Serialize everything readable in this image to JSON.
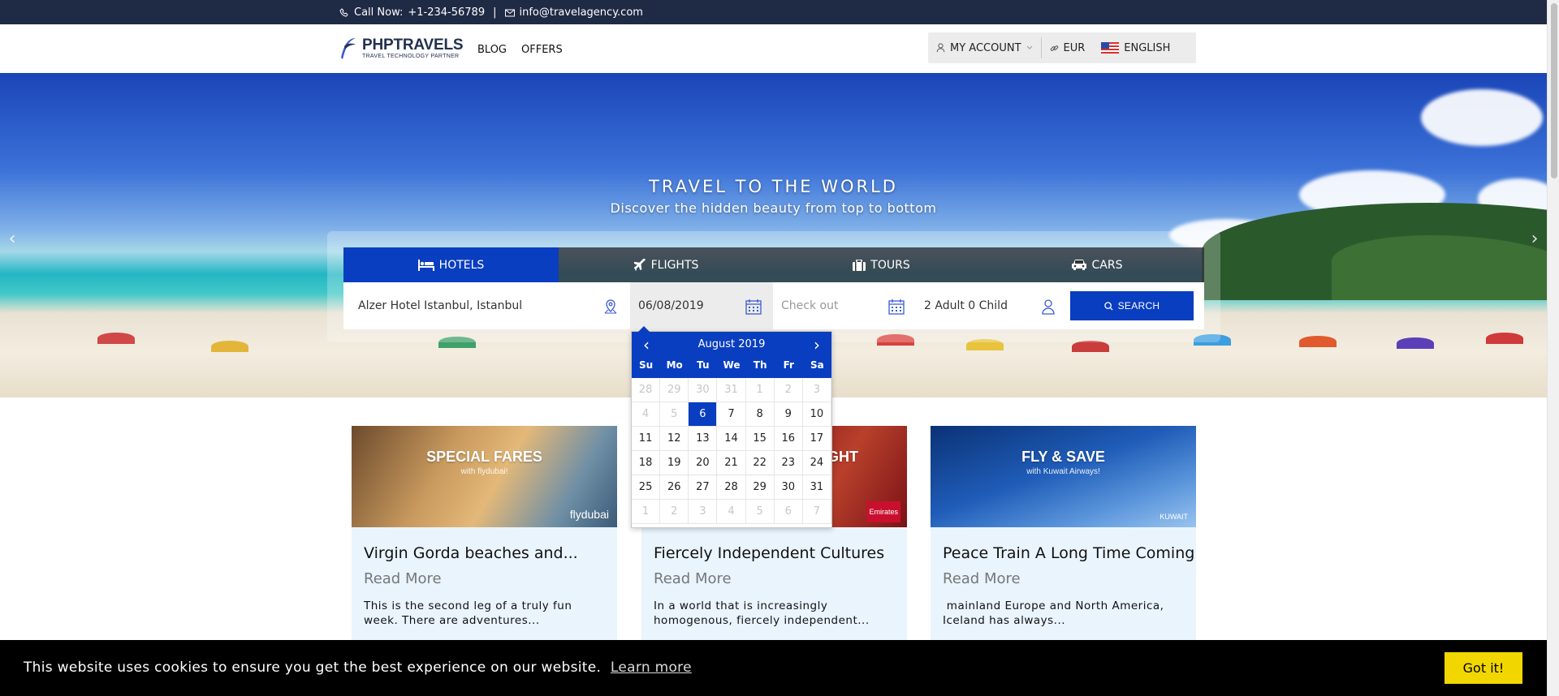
{
  "topbar": {
    "call_label": "Call Now:",
    "phone": "+1-234-56789",
    "separator": "|",
    "email": "info@travelagency.com"
  },
  "logo": {
    "name": "PHPTRAVELS",
    "tagline": "TRAVEL TECHNOLOGY PARTNER"
  },
  "nav": {
    "blog": "BLOG",
    "offers": "OFFERS"
  },
  "account": {
    "my_account": "MY ACCOUNT",
    "currency": "EUR",
    "language": "ENGLISH"
  },
  "hero": {
    "title": "TRAVEL TO THE WORLD",
    "subtitle": "Discover the hidden beauty from top to bottom"
  },
  "tabs": [
    {
      "label": "HOTELS",
      "icon": "bed-icon"
    },
    {
      "label": "FLIGHTS",
      "icon": "plane-icon"
    },
    {
      "label": "TOURS",
      "icon": "suitcase-icon"
    },
    {
      "label": "CARS",
      "icon": "car-icon"
    }
  ],
  "search": {
    "location": "Alzer Hotel Istanbul, Istanbul",
    "checkin": "06/08/2019",
    "checkout_placeholder": "Check out",
    "guests": "2 Adult 0 Child",
    "button": "SEARCH"
  },
  "datepicker": {
    "month_label": "August 2019",
    "weekdays": [
      "Su",
      "Mo",
      "Tu",
      "We",
      "Th",
      "Fr",
      "Sa"
    ],
    "days": [
      [
        "28",
        "29",
        "30",
        "31",
        "1",
        "2",
        "3"
      ],
      [
        "4",
        "5",
        "6",
        "7",
        "8",
        "9",
        "10"
      ],
      [
        "11",
        "12",
        "13",
        "14",
        "15",
        "16",
        "17"
      ],
      [
        "18",
        "19",
        "20",
        "21",
        "22",
        "23",
        "24"
      ],
      [
        "25",
        "26",
        "27",
        "28",
        "29",
        "30",
        "31"
      ],
      [
        "1",
        "2",
        "3",
        "4",
        "5",
        "6",
        "7"
      ]
    ],
    "selected_day": "6"
  },
  "cards": [
    {
      "banner_title": "SPECIAL FARES",
      "banner_subtitle": "with flydubai!",
      "brand": "flydubai",
      "title": "Virgin Gorda beaches and...",
      "read_more": "Read More",
      "excerpt": "This is the second leg of a truly fun week. There are adventures..."
    },
    {
      "banner_title": "GHT",
      "banner_subtitle": "",
      "brand": "Emirates",
      "title": "Fiercely Independent Cultures",
      "read_more": "Read More",
      "excerpt": "In a world that is increasingly homogenous, fiercely independent..."
    },
    {
      "banner_title": "FLY & SAVE",
      "banner_subtitle": "with Kuwait Airways!",
      "brand": "KUWAIT",
      "title": "Peace Train A Long Time Coming",
      "read_more": "Read More",
      "excerpt": " mainland Europe and North America, Iceland has always..."
    }
  ],
  "cookie": {
    "message": "This website uses cookies to ensure you get the best experience on our website.",
    "learn_more": "Learn more",
    "button": "Got it!"
  },
  "colors": {
    "topbar": "#1f2a44",
    "primary": "#0a3ec0",
    "cookie_button": "#f1d600"
  }
}
